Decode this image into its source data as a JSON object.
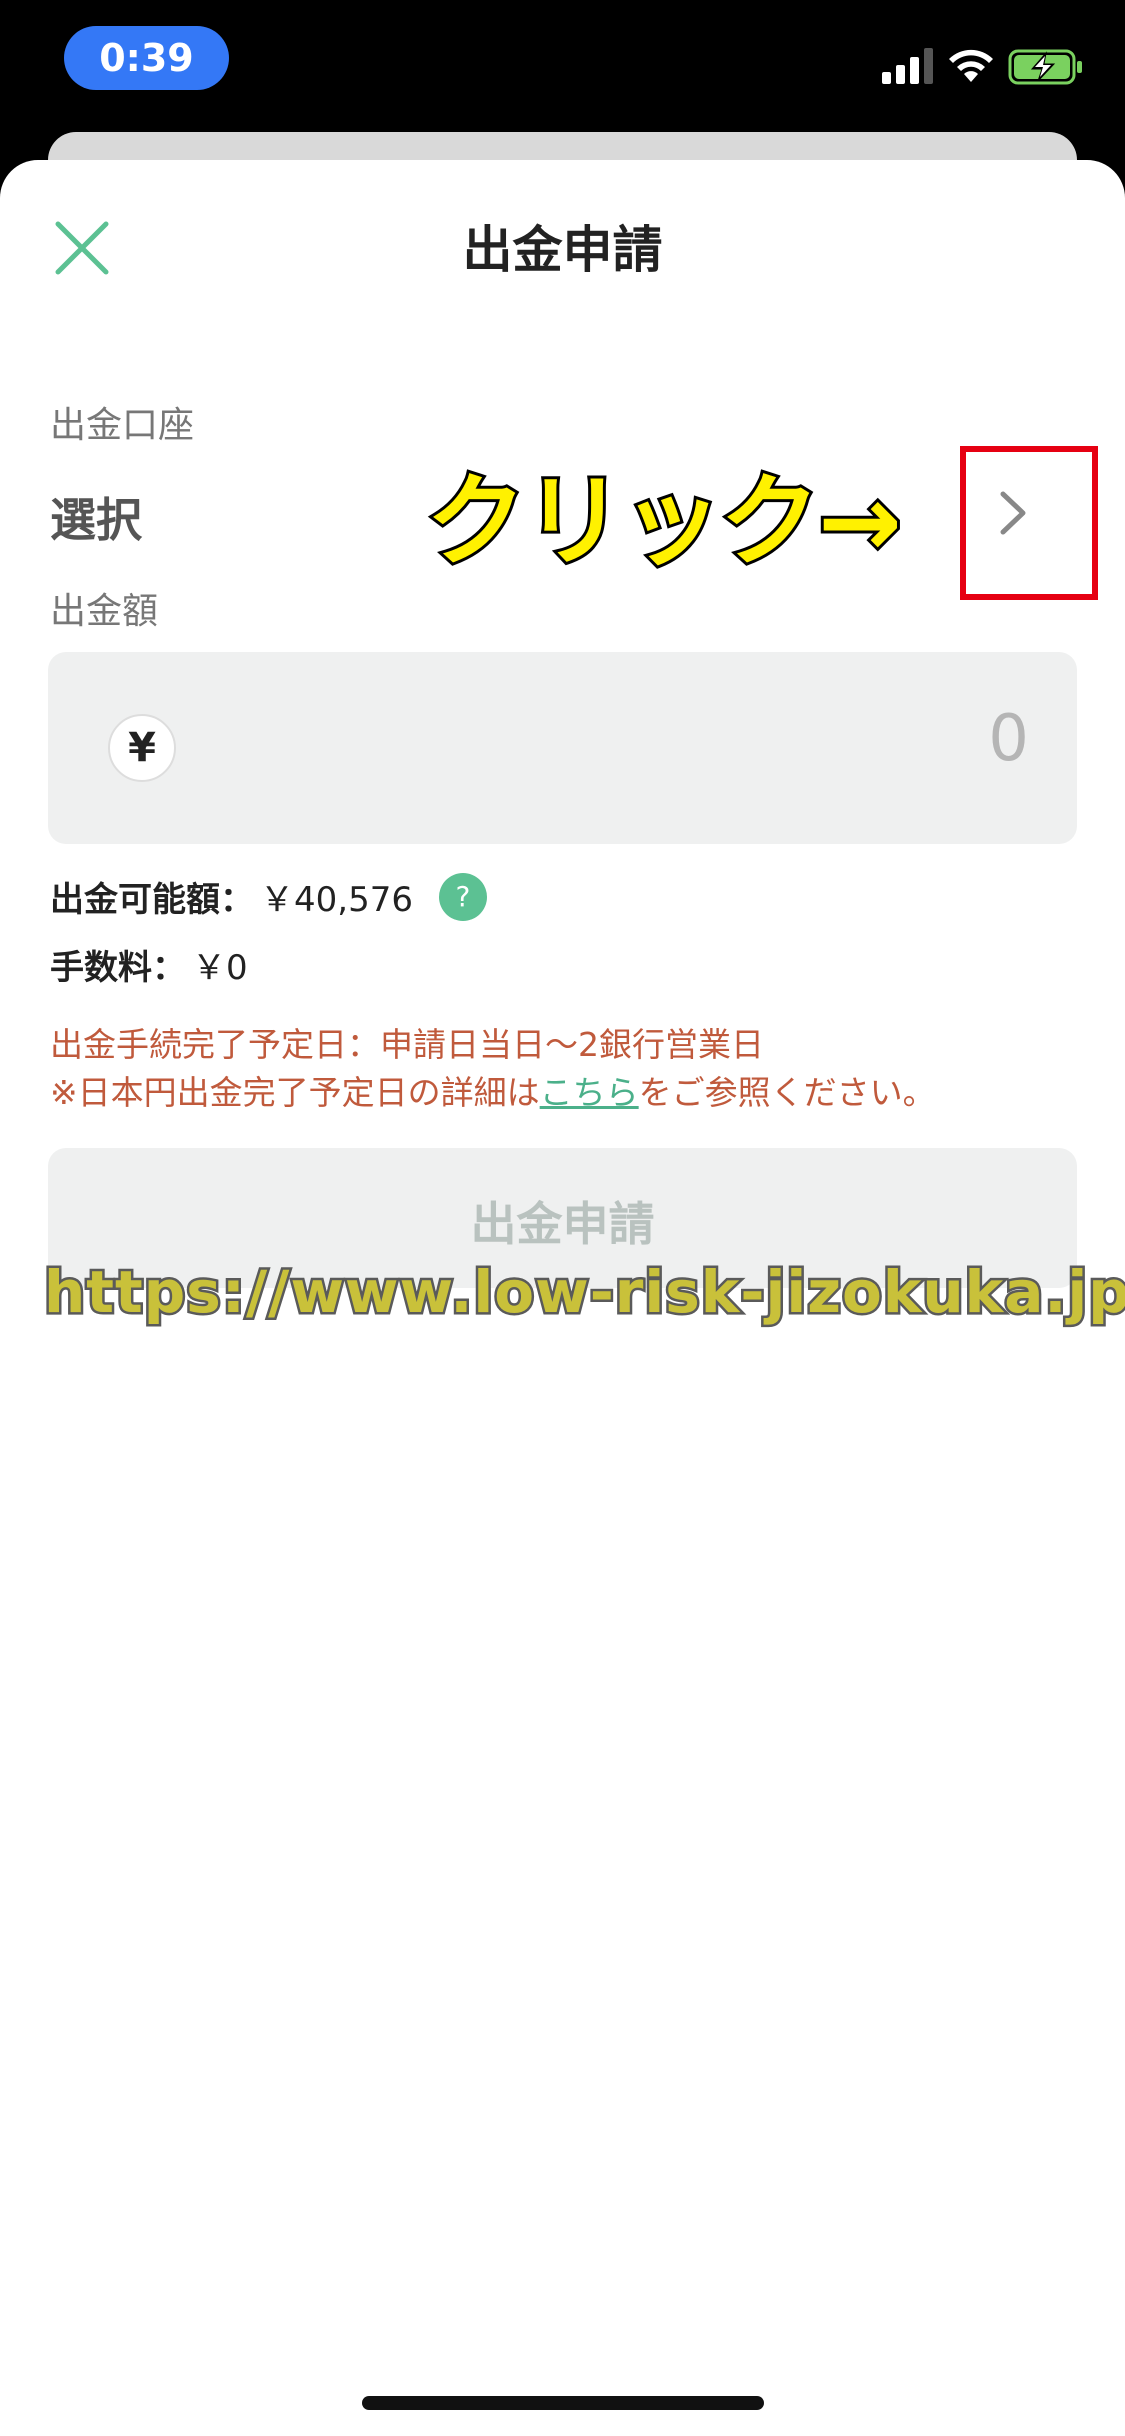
{
  "status_bar": {
    "time": "0:39",
    "icons": [
      "signal-icon",
      "wifi-icon",
      "battery-charging-icon"
    ]
  },
  "header": {
    "title": "出金申請",
    "close_icon": "close-icon"
  },
  "withdraw_account": {
    "label": "出金口座",
    "value": "選択",
    "chevron_icon": "chevron-right-icon"
  },
  "annotation": {
    "text": "クリック→"
  },
  "amount": {
    "label": "出金額",
    "currency_symbol": "¥",
    "value": "0"
  },
  "available": {
    "label": "出金可能額：",
    "value": "￥40,576",
    "help_icon": "?"
  },
  "fee": {
    "label": "手数料：",
    "value": "￥0"
  },
  "notice": {
    "line1": "出金手続完了予定日：申請日当日〜2銀行営業日",
    "line2_prefix": "※日本円出金完了予定日の詳細は",
    "line2_link": "こちら",
    "line2_suffix": "をご参照ください。"
  },
  "submit_button": {
    "label": "出金申請"
  },
  "watermark": {
    "text": "https://www.low-risk-jizokuka.jp/"
  },
  "colors": {
    "accent_green": "#5cc193",
    "notice_red": "#c05a3c",
    "annotation_yellow": "#fff100",
    "highlight_red": "#e60012",
    "time_pill_blue": "#3478f6"
  }
}
